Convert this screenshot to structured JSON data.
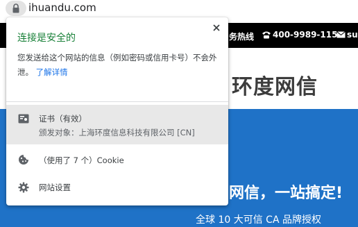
{
  "browser": {
    "url": "ihuandu.com"
  },
  "website": {
    "hotline_label": "务热线",
    "phone_number": "400-9989-115",
    "mail_text": "sup",
    "brand_name": "环度网信",
    "banner_headline": "网信，一站搞定!",
    "banner_subtitle": "全球 10 大可信 CA 品牌授权"
  },
  "popup": {
    "title": "连接是安全的",
    "description": "您发送给这个网站的信息（例如密码或信用卡号）不会外泄。",
    "learn_more": "了解详情",
    "certificate": {
      "title": "证书（有效）",
      "subject": "颁发对象：上海环度信息科技有限公司 [CN]"
    },
    "cookie_label": "（使用了 7 个）Cookie",
    "settings_label": "网站设置"
  },
  "colors": {
    "secure_green": "#188038",
    "link_blue": "#1a73e8",
    "banner_blue": "#1f72c7"
  }
}
